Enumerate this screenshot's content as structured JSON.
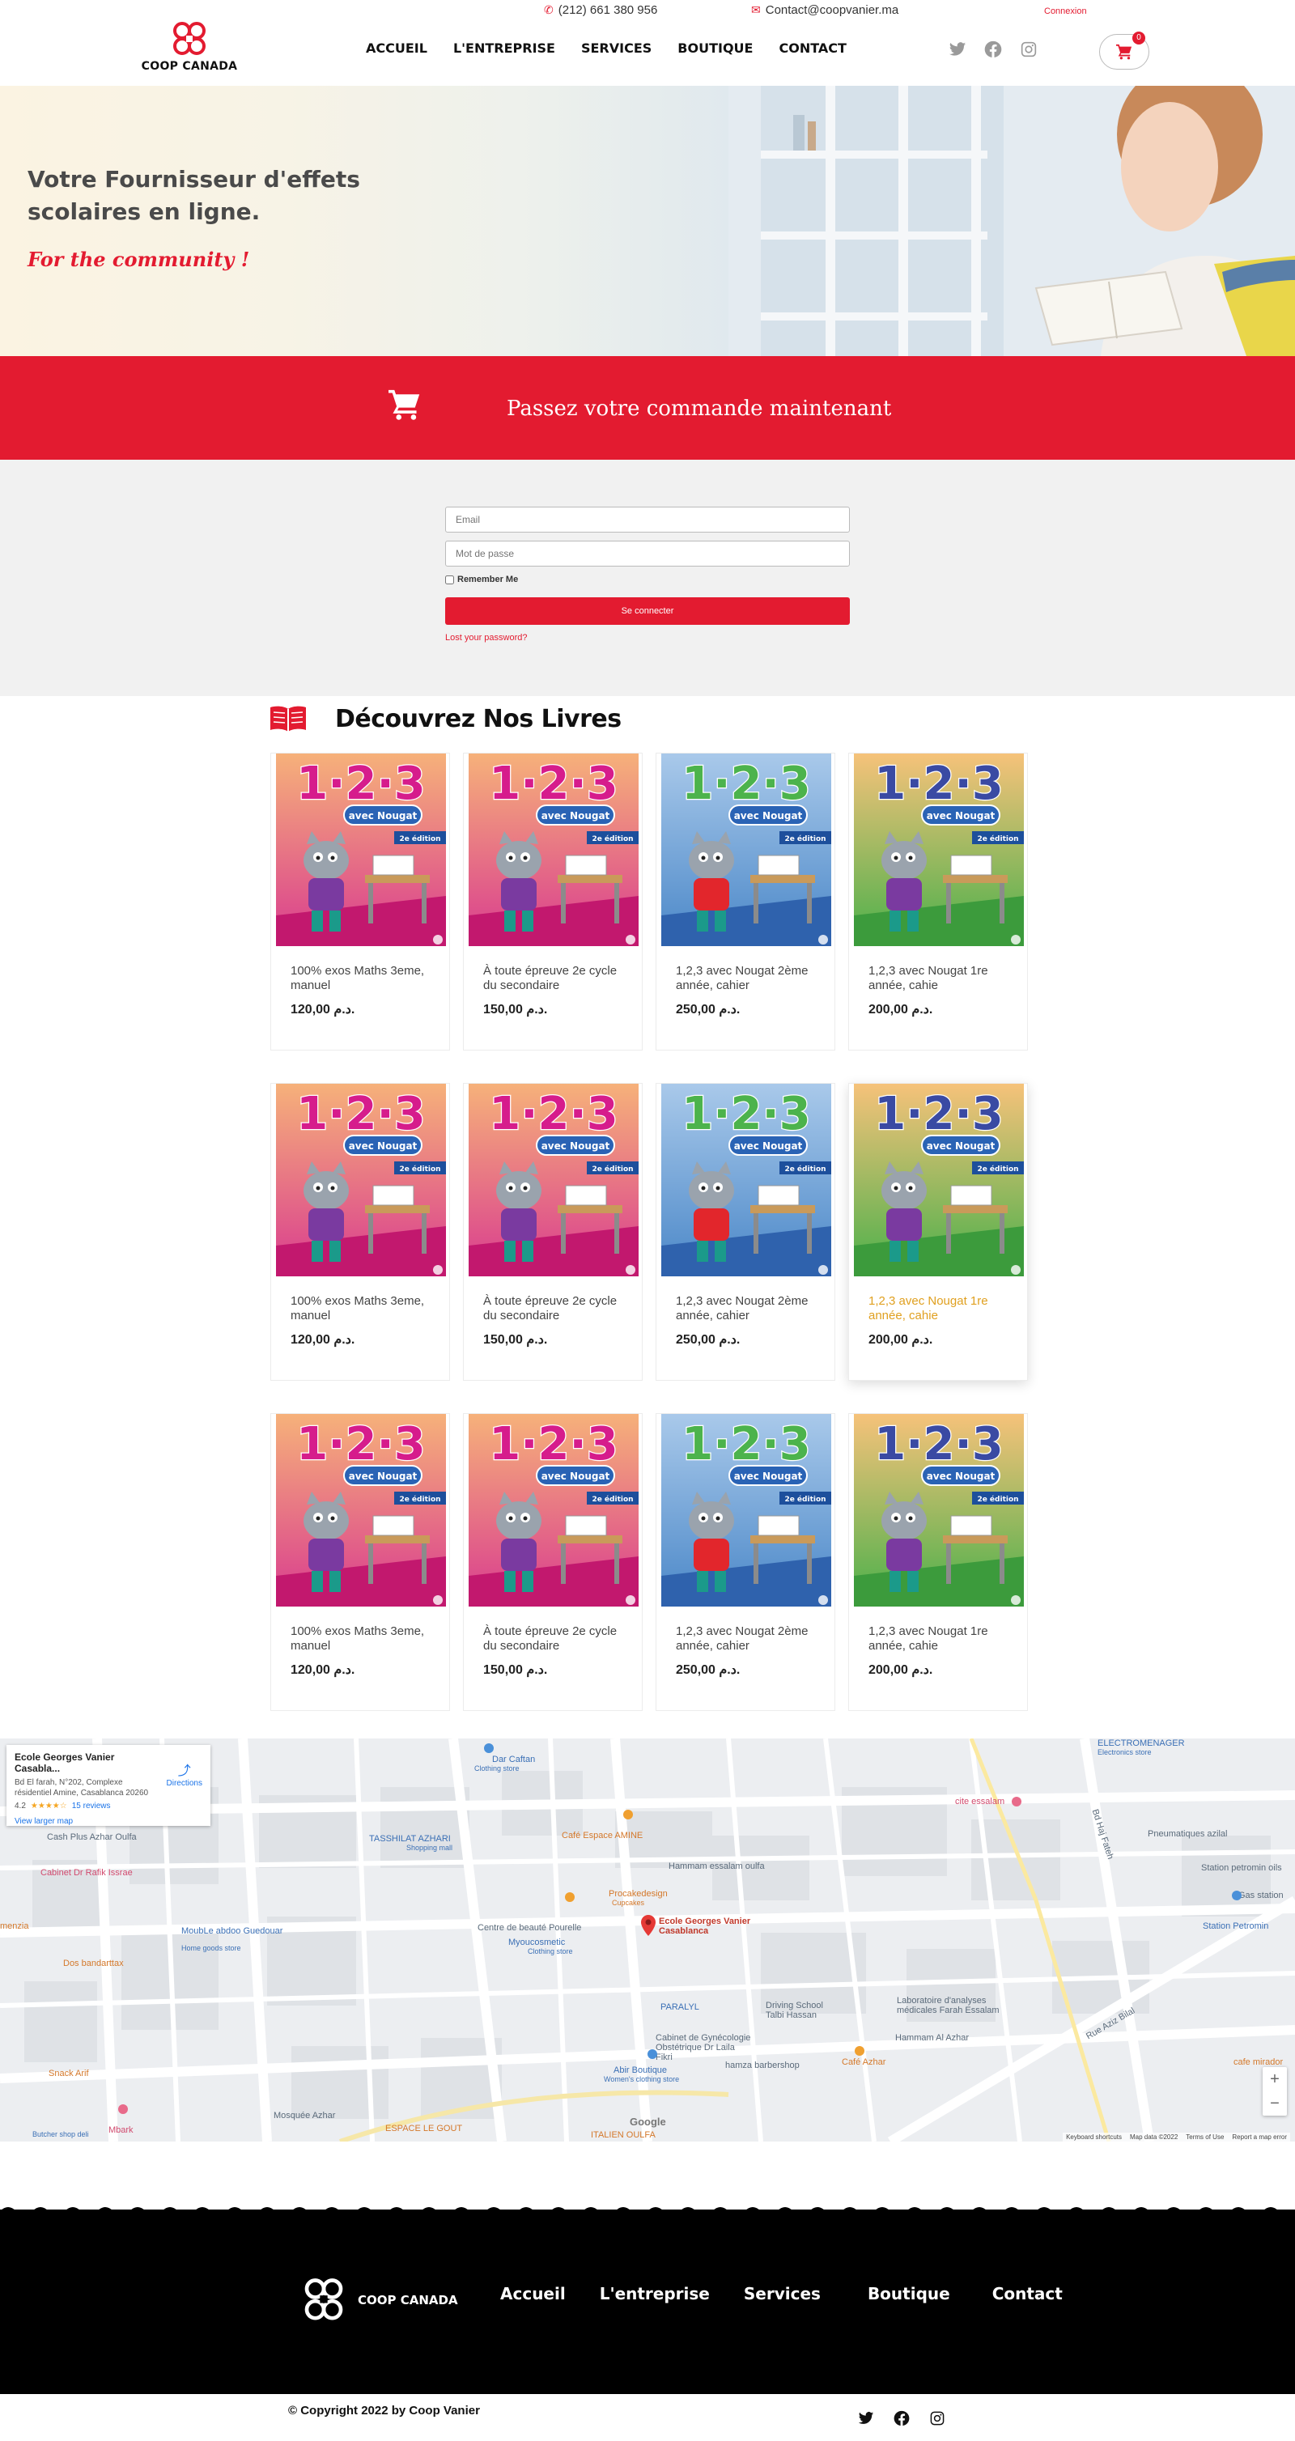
{
  "topbar": {
    "phone": "(212) 661 380 956",
    "email": "Contact@coopvanier.ma",
    "login_link": "Connexion"
  },
  "brand": {
    "name": "COOP CANADA",
    "primary_color": "#e31b30"
  },
  "nav": {
    "items": [
      "ACCUEIL",
      "L'ENTREPRISE",
      "SERVICES",
      "BOUTIQUE",
      "CONTACT"
    ]
  },
  "cart": {
    "count": "0"
  },
  "hero": {
    "title": "Votre Fournisseur d'effets scolaires en ligne.",
    "slogan": "For the community !"
  },
  "order_banner": {
    "text": "Passez votre commande maintenant"
  },
  "login_form": {
    "email_placeholder": "Email",
    "password_placeholder": "Mot de passe",
    "remember_label": "Remember Me",
    "submit_label": "Se connecter",
    "lost_password": "Lost your password?"
  },
  "books": {
    "heading": "Découvrez Nos Livres",
    "products": [
      {
        "name": "100% exos Maths 3eme, manuel",
        "price": "120,00 د.م."
      },
      {
        "name": "À toute épreuve 2e cycle du secondaire",
        "price": "150,00 د.م."
      },
      {
        "name": "1,2,3 avec Nougat 2ème année, cahier",
        "price": "250,00 د.م."
      },
      {
        "name": "1,2,3 avec Nougat 1re année, cahie",
        "price": "200,00 د.م."
      },
      {
        "name": "100% exos Maths 3eme, manuel",
        "price": "120,00 د.م."
      },
      {
        "name": "À toute épreuve 2e cycle du secondaire",
        "price": "150,00 د.م."
      },
      {
        "name": "1,2,3 avec Nougat 2ème année, cahier",
        "price": "250,00 د.م."
      },
      {
        "name": "1,2,3 avec Nougat 1re année, cahie",
        "price": "200,00 د.م."
      },
      {
        "name": "100% exos Maths 3eme, manuel",
        "price": "120,00 د.م."
      },
      {
        "name": "À toute épreuve 2e cycle du secondaire",
        "price": "150,00 د.م."
      },
      {
        "name": "1,2,3 avec Nougat 2ème année, cahier",
        "price": "250,00 د.م."
      },
      {
        "name": "1,2,3 avec Nougat 1re année, cahie",
        "price": "200,00 د.م."
      }
    ],
    "cover_text": {
      "numbers": "1·2·3",
      "subtitle": "avec Nougat",
      "edition": "2e édition"
    }
  },
  "map": {
    "place_name": "Ecole Georges Vanier Casabla...",
    "address": "Bd El farah, N°202, Complexe résidentiel Amine, Casablanca 20260",
    "rating": "4.2",
    "stars": "★★★★☆",
    "reviews": "15 reviews",
    "directions": "Directions",
    "larger_map": "View larger map",
    "pin_label": "Ecole Georges Vanier Casablanca",
    "labels": {
      "dar_caftan": "Dar Caftan",
      "dar_caftan_sub": "Clothing store",
      "tasshilat": "TASSHILAT AZHARI",
      "tasshilat_sub": "Shopping mall",
      "cafe_amine": "Café Espace AMINE",
      "hammam": "Hammam essalam oulfa",
      "procakedesign": "Procakedesign",
      "procakedesign_sub": "Cupcakes",
      "centre_beaute": "Centre de beauté Pourelle",
      "myoucosmetic": "Myoucosmetic",
      "myoucosmetic_sub": "Clothing store",
      "cash_plus": "Cash Plus Azhar Oulfa",
      "cabinet_rafik": "Cabinet Dr Rafik Issrae",
      "moublea": "MoubLe abdoo Guedouar",
      "moublea_sub": "Home goods store",
      "dos_bandarttax": "Dos bandarttax",
      "snack_arif": "Snack Arif",
      "paralyl": "PARALYL",
      "driving_school": "Driving School Talbi Hassan",
      "labo": "Laboratoire d'analyses médicales Farah Essalam",
      "cabinet_gyneco": "Cabinet de Gynécologie Obstétrique Dr Laila Fikri",
      "hamza": "hamza barbershop",
      "abir": "Abir Boutique",
      "abir_sub": "Women's clothing store",
      "cafe_azhar": "Café Azhar",
      "hammam_al_azhar": "Hammam Al Azhar",
      "cite_essalam": "cite essalam",
      "bd_haj_fateh": "Bd Haj Fateh",
      "pneumatiques": "Pneumatiques azilal",
      "station_petromin_oils": "Station petromin oils",
      "gas_station": "Gas station",
      "station_petromin": "Station Petromin",
      "electro": "ELECTROMENAGER",
      "electro_sub": "Electronics store",
      "rue_aziz": "Rue Aziz Bilal",
      "cafe_mirador": "cafe mirador",
      "mosquee": "Mosquée Azhar",
      "espace_gout": "ESPACE LE GOUT",
      "italien": "ITALIEN OULFA",
      "mbark": "Mbark",
      "butcher": "Butcher shop deli",
      "menzia": "menzia"
    },
    "google": "Google",
    "attrib_shortcuts": "Keyboard shortcuts",
    "attrib_data": "Map data ©2022",
    "attrib_terms": "Terms of Use",
    "attrib_report": "Report a map error"
  },
  "footer": {
    "brand": "COOP CANADA",
    "nav": [
      "Accueil",
      "L'entreprise",
      "Services",
      "Boutique",
      "Contact"
    ],
    "copyright": "© Copyright 2022 by Coop Vanier"
  }
}
